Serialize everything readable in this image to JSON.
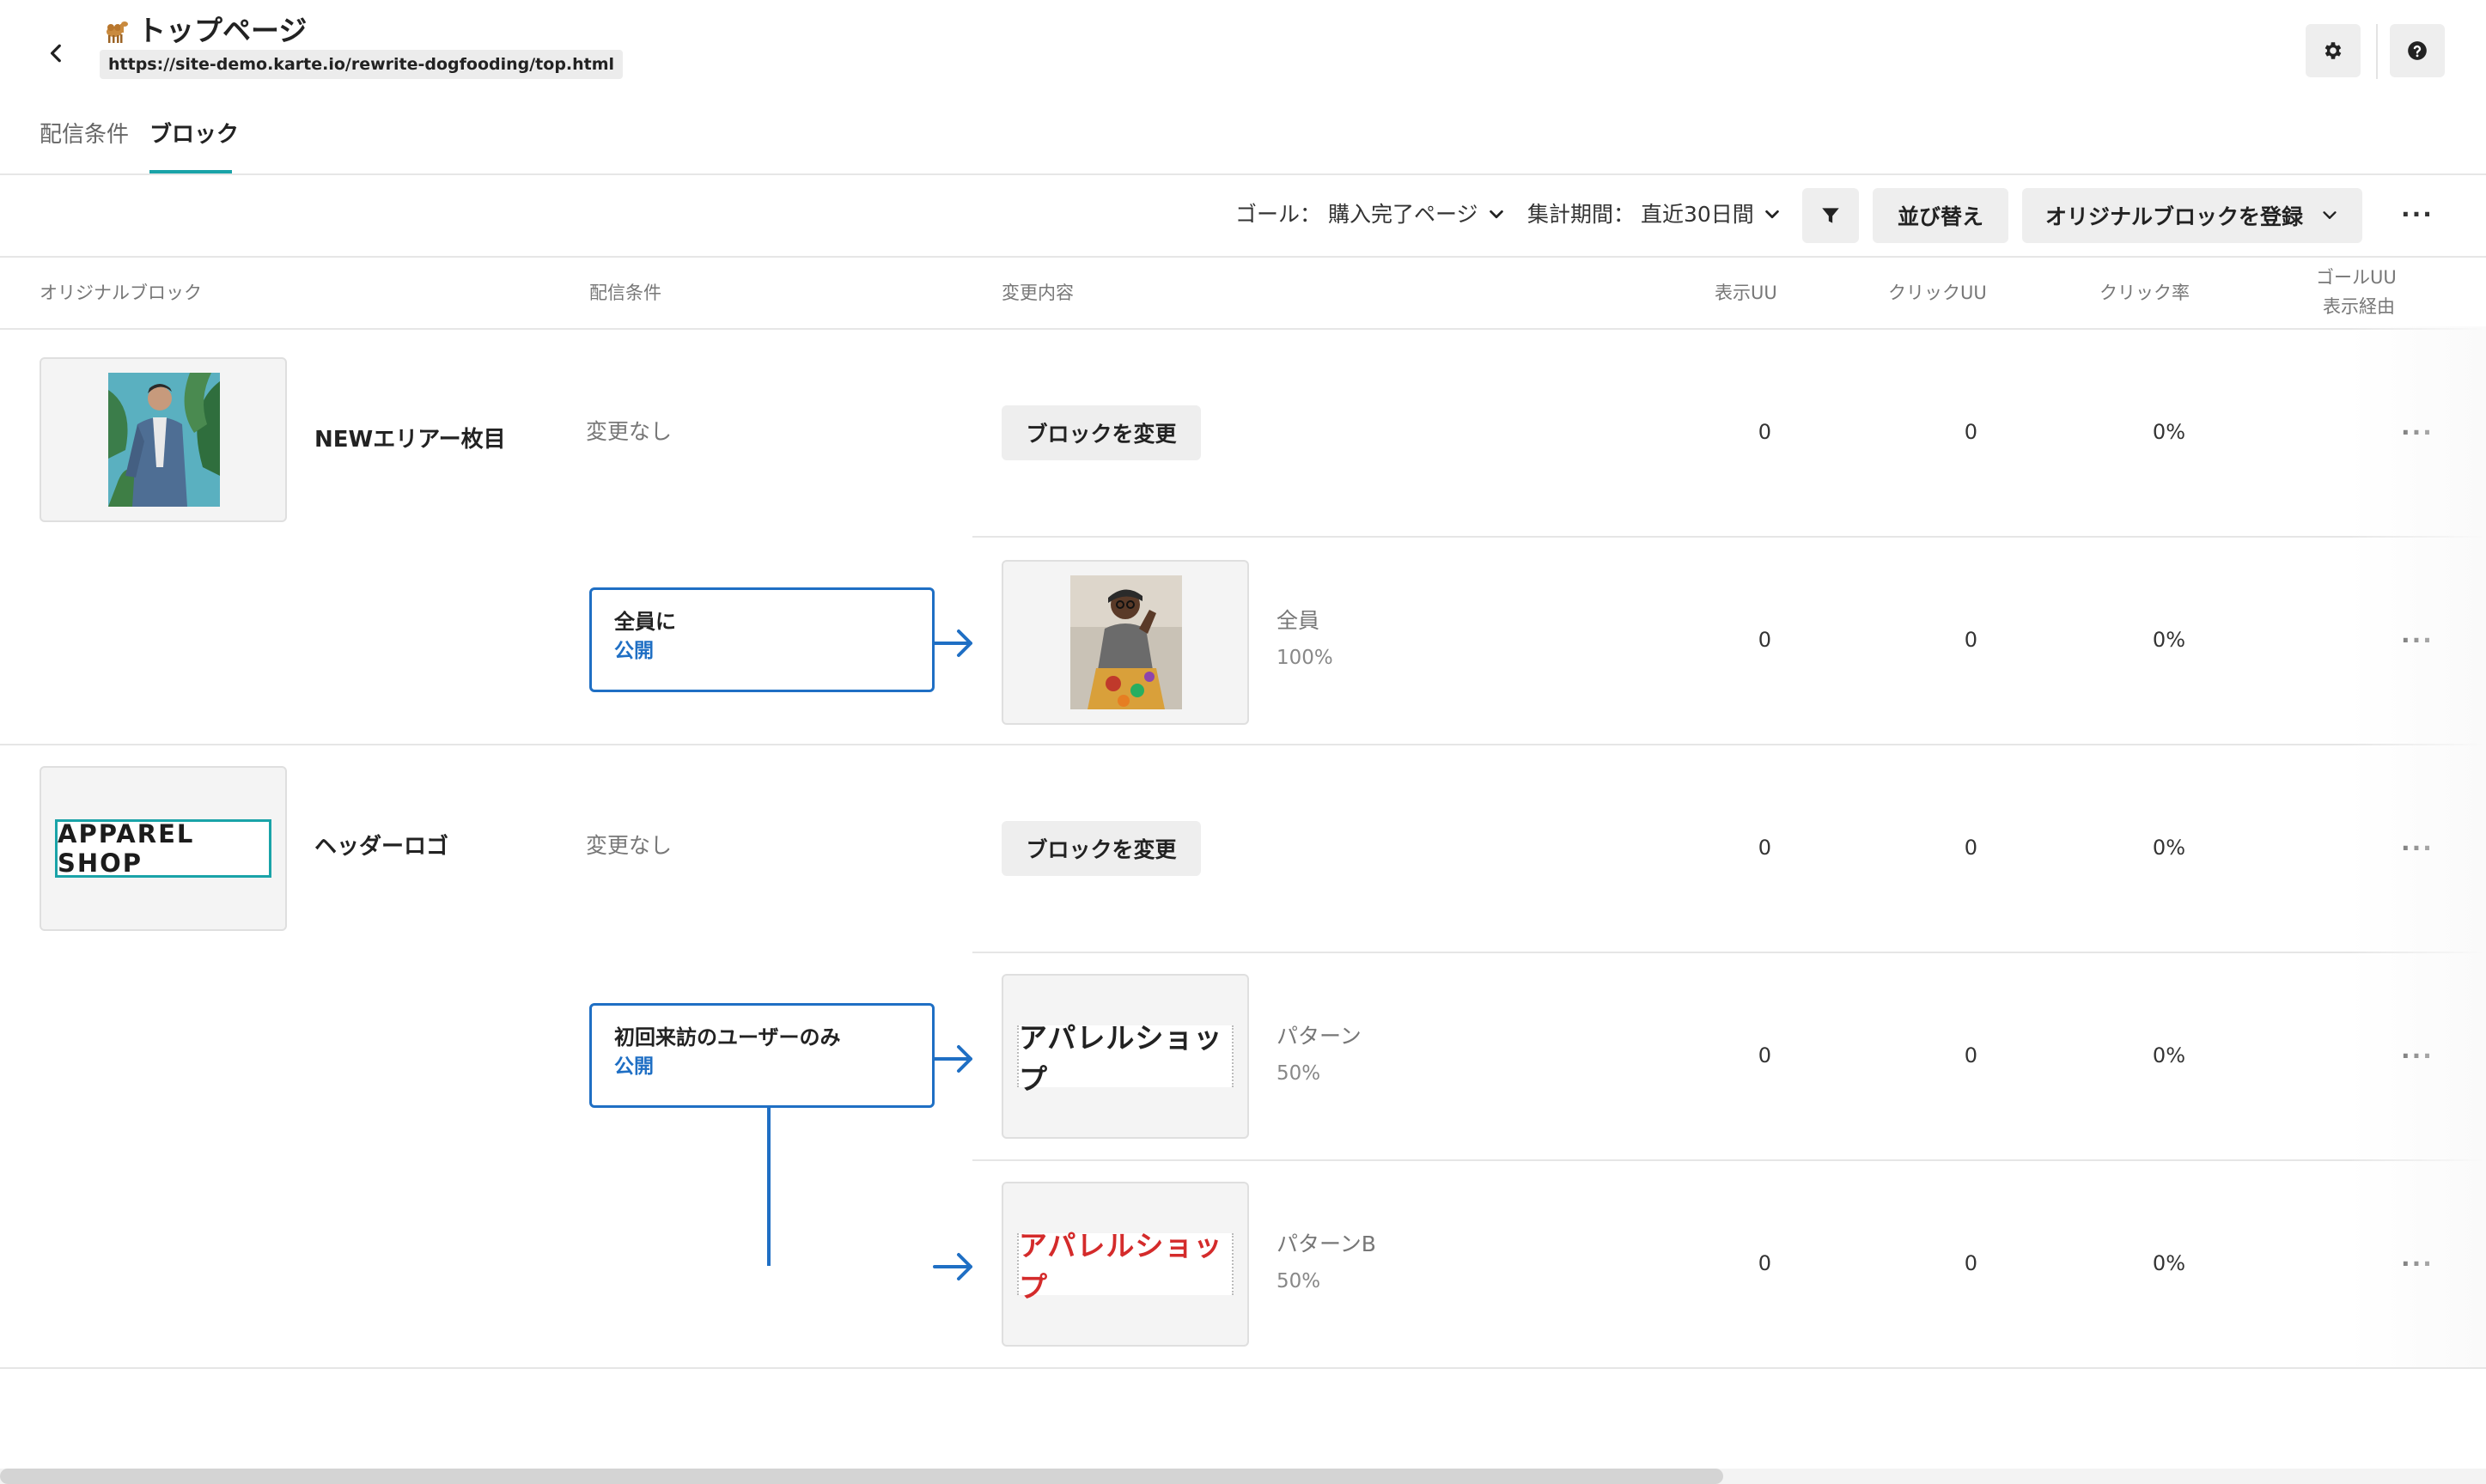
{
  "header": {
    "title": "トップページ",
    "url": "https://site-demo.karte.io/rewrite-dogfooding/top.html",
    "page_icon": "camel-icon",
    "settings_icon": "gear-icon",
    "help_icon": "help-icon"
  },
  "tabs": [
    {
      "label": "配信条件",
      "active": false
    },
    {
      "label": "ブロック",
      "active": true
    }
  ],
  "toolbar": {
    "goal_label": "ゴール：",
    "goal_value": "購入完了ページ",
    "period_label": "集計期間：",
    "period_value": "直近30日間",
    "sort_label": "並び替え",
    "register_label": "オリジナルブロックを登録",
    "filter_icon": "filter-icon",
    "more_icon": "more-horizontal-icon"
  },
  "table": {
    "headers": {
      "original_block": "オリジナルブロック",
      "condition": "配信条件",
      "change": "変更内容",
      "view_uu": "表示UU",
      "click_uu": "クリックUU",
      "click_rate": "クリック率",
      "goal_uu_line1": "ゴールUU",
      "goal_uu_line2": "表示経由"
    },
    "blocks": [
      {
        "name": "NEWエリアー枚目",
        "thumbnail": "man-in-denim-jacket-image",
        "default_row": {
          "condition": "変更なし",
          "action": "ブロックを変更",
          "view_uu": "0",
          "click_uu": "0",
          "click_rate": "0%"
        },
        "conditions": [
          {
            "title": "全員に",
            "status": "公開",
            "variants": [
              {
                "name": "全員",
                "pct": "100%",
                "thumbnail": "woman-portrait-image",
                "view_uu": "0",
                "click_uu": "0",
                "click_rate": "0%"
              }
            ]
          }
        ]
      },
      {
        "name": "ヘッダーロゴ",
        "thumbnail_text": "APPAREL SHOP",
        "default_row": {
          "condition": "変更なし",
          "action": "ブロックを変更",
          "view_uu": "0",
          "click_uu": "0",
          "click_rate": "0%"
        },
        "conditions": [
          {
            "title": "初回来訪のユーザーのみ",
            "status": "公開",
            "variants": [
              {
                "name": "パターン",
                "pct": "50%",
                "thumbnail_text": "アパレルショップ",
                "thumbnail_color": "#222222",
                "view_uu": "0",
                "click_uu": "0",
                "click_rate": "0%"
              },
              {
                "name": "パターンB",
                "pct": "50%",
                "thumbnail_text": "アパレルショップ",
                "thumbnail_color": "#d42b2b",
                "view_uu": "0",
                "click_uu": "0",
                "click_rate": "0%"
              }
            ]
          }
        ]
      }
    ]
  },
  "colors": {
    "accent": "#1aa3a8",
    "condition_border": "#1f6fc4",
    "published": "#1f6fc4"
  }
}
